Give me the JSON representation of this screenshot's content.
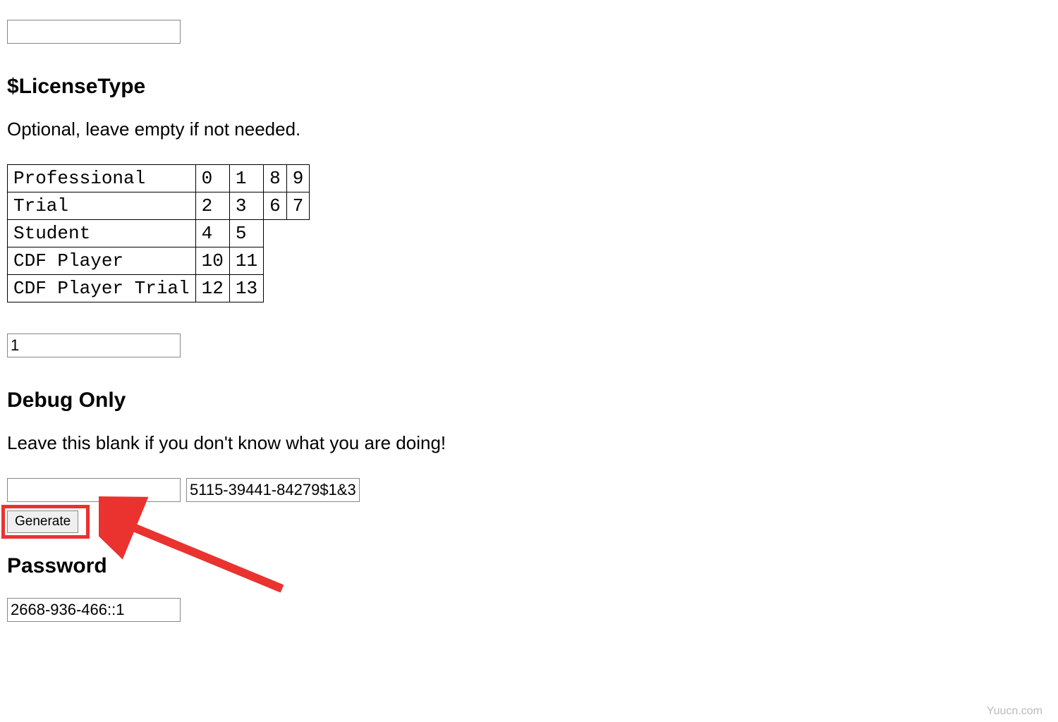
{
  "top_input": "",
  "license": {
    "heading": "$LicenseType",
    "description": "Optional, leave empty if not needed.",
    "input_value": "1",
    "table_rows": [
      {
        "name": "Professional",
        "c2": "0",
        "c3": "1",
        "c4": "8",
        "c5": "9"
      },
      {
        "name": "Trial",
        "c2": "2",
        "c3": "3",
        "c4": "6",
        "c5": "7"
      },
      {
        "name": "Student",
        "c2": "4",
        "c3": "5",
        "c4": "",
        "c5": ""
      },
      {
        "name": "CDF Player",
        "c2": "10",
        "c3": "11",
        "c4": "",
        "c5": ""
      },
      {
        "name": "CDF Player Trial",
        "c2": "12",
        "c3": "13",
        "c4": "",
        "c5": ""
      }
    ]
  },
  "debug": {
    "heading": "Debug Only",
    "description": "Leave this blank if you don't know what you are doing!",
    "input1_value": "",
    "input2_value": "5115-39441-84279$1&3:",
    "button_label": "Generate"
  },
  "password": {
    "heading": "Password",
    "value": "2668-936-466::1"
  },
  "footer": "Yuucn.com"
}
